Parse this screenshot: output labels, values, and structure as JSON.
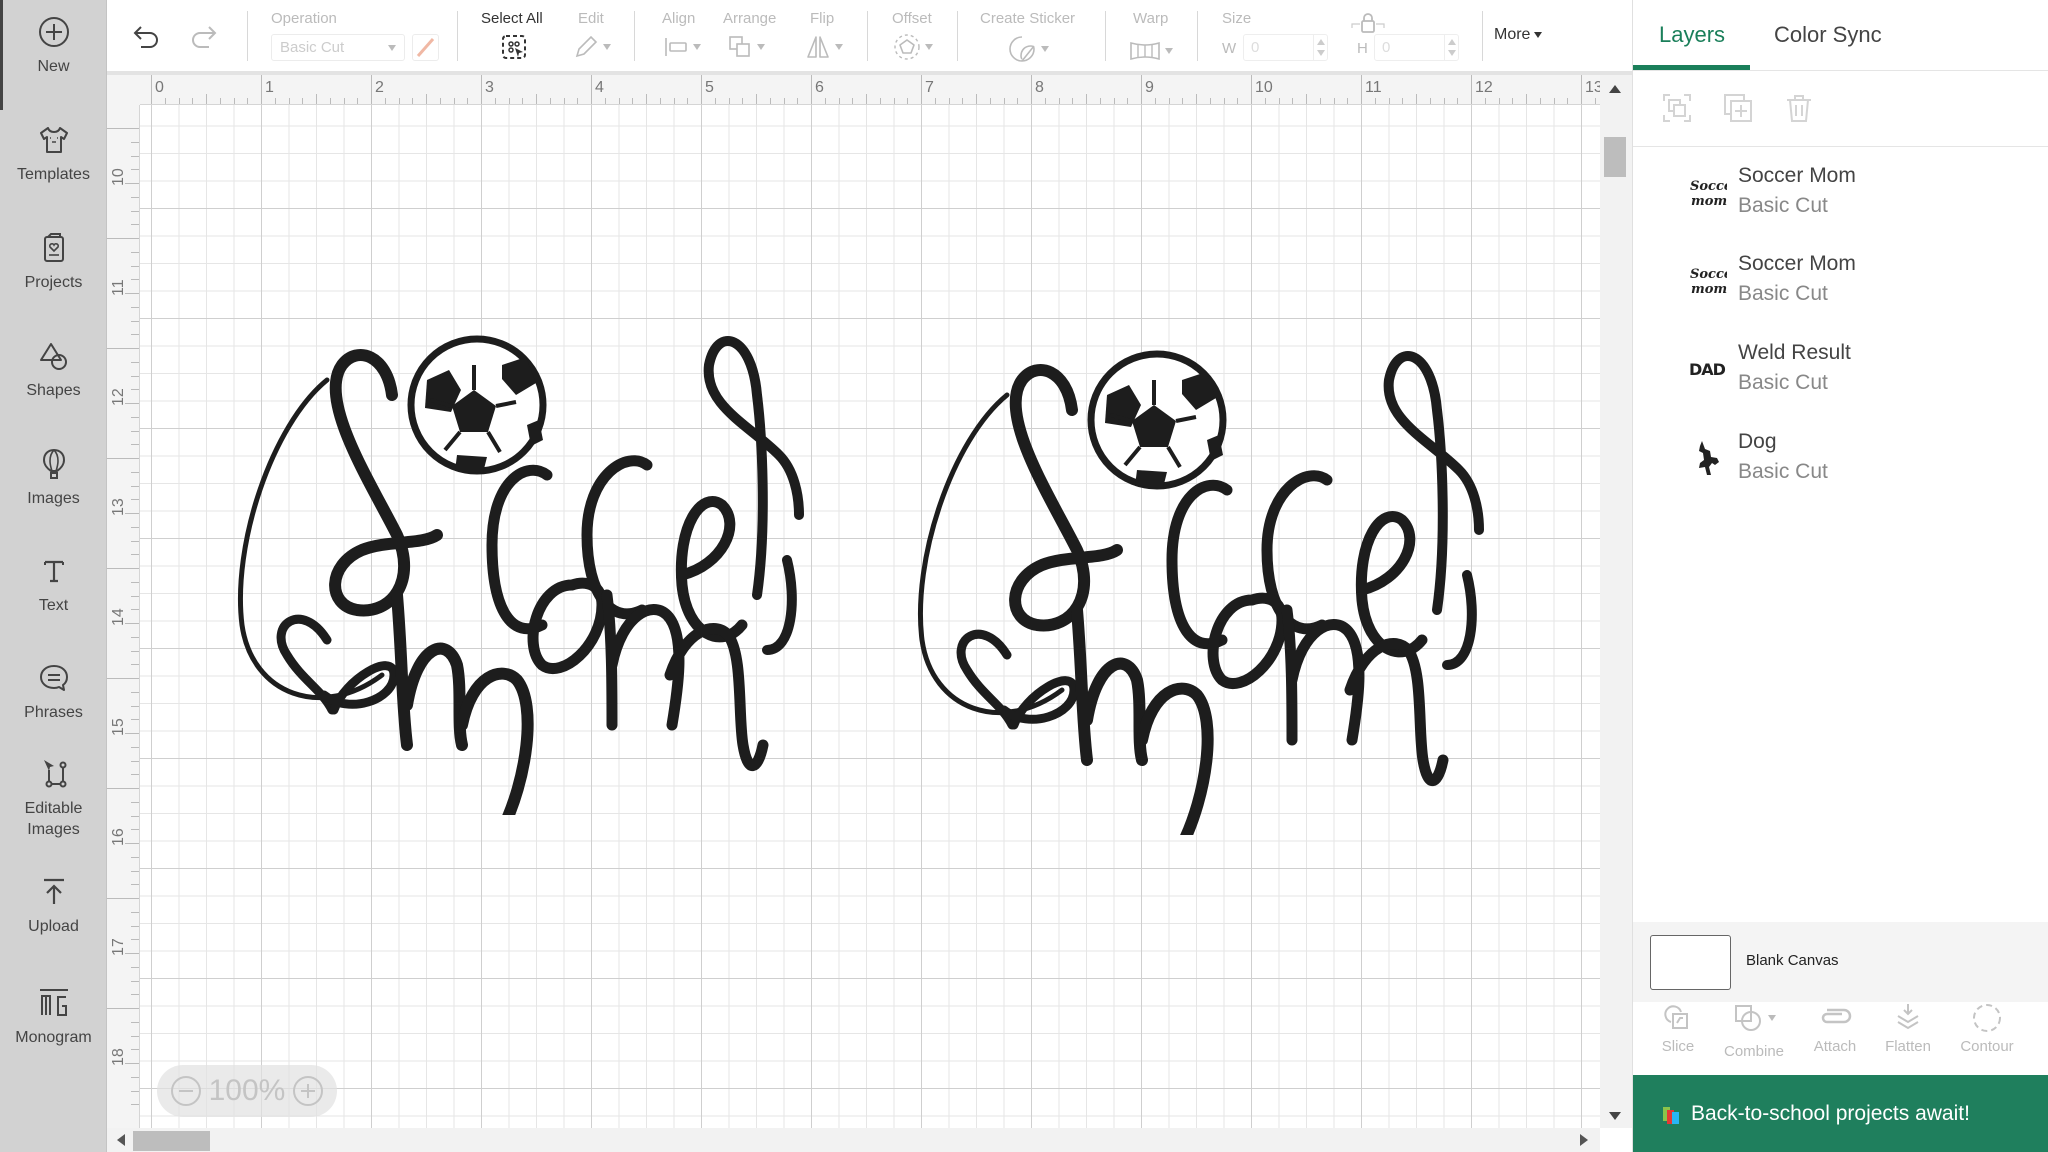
{
  "sidebar": {
    "items": [
      {
        "label": "New",
        "icon": "plus-circle-icon"
      },
      {
        "label": "Templates",
        "icon": "shirt-icon"
      },
      {
        "label": "Projects",
        "icon": "card-heart-icon"
      },
      {
        "label": "Shapes",
        "icon": "shapes-icon"
      },
      {
        "label": "Images",
        "icon": "balloon-icon"
      },
      {
        "label": "Text",
        "icon": "text-t-icon"
      },
      {
        "label": "Phrases",
        "icon": "speech-bubble-icon"
      },
      {
        "label": "Editable Images",
        "label_line1": "Editable",
        "label_line2": "Images",
        "icon": "editable-image-icon"
      },
      {
        "label": "Upload",
        "icon": "upload-icon"
      },
      {
        "label": "Monogram",
        "icon": "monogram-icon"
      }
    ]
  },
  "toolbar": {
    "undo_icon": "undo-icon",
    "redo_icon": "redo-icon",
    "operation_label": "Operation",
    "operation_value": "Basic Cut",
    "select_all_label": "Select All",
    "edit_label": "Edit",
    "align_label": "Align",
    "arrange_label": "Arrange",
    "flip_label": "Flip",
    "offset_label": "Offset",
    "create_sticker_label": "Create Sticker",
    "warp_label": "Warp",
    "size_label": "Size",
    "width_label": "W",
    "width_value": "0",
    "height_label": "H",
    "height_value": "0",
    "more_label": "More"
  },
  "canvas": {
    "ruler_top": [
      "0",
      "1",
      "2",
      "3",
      "4",
      "5",
      "6",
      "7",
      "8",
      "9",
      "10",
      "11",
      "12",
      "13"
    ],
    "ruler_left": [
      "10",
      "11",
      "12",
      "13",
      "14",
      "15",
      "16",
      "17",
      "18"
    ],
    "zoom_level": "100%",
    "designs": [
      {
        "name": "Soccer Mom",
        "text_line1": "Soccer",
        "text_line2": "mom"
      },
      {
        "name": "Soccer Mom",
        "text_line1": "Soccer",
        "text_line2": "mom"
      }
    ]
  },
  "panel": {
    "tabs": [
      {
        "label": "Layers",
        "active": true
      },
      {
        "label": "Color Sync",
        "active": false
      }
    ],
    "layer_tools": [
      "group-icon",
      "duplicate-icon",
      "delete-icon"
    ],
    "layers": [
      {
        "name": "Soccer Mom",
        "operation": "Basic Cut",
        "thumb": "soccer-mom-thumb"
      },
      {
        "name": "Soccer Mom",
        "operation": "Basic Cut",
        "thumb": "soccer-mom-thumb"
      },
      {
        "name": "Weld Result",
        "operation": "Basic Cut",
        "thumb": "dad-thumb",
        "thumb_text": "DAD"
      },
      {
        "name": "Dog",
        "operation": "Basic Cut",
        "thumb": "dog-thumb"
      }
    ],
    "blank_canvas_label": "Blank Canvas",
    "bottom_tools": [
      {
        "label": "Slice",
        "icon": "slice-icon"
      },
      {
        "label": "Combine",
        "icon": "combine-icon"
      },
      {
        "label": "Attach",
        "icon": "attach-icon"
      },
      {
        "label": "Flatten",
        "icon": "flatten-icon"
      },
      {
        "label": "Contour",
        "icon": "contour-icon"
      }
    ],
    "promo_text": "Back-to-school projects await!"
  },
  "colors": {
    "accent": "#1a7f5a",
    "promo_bg": "#1f7f5d",
    "sidebar_bg": "#d2d2d2"
  }
}
